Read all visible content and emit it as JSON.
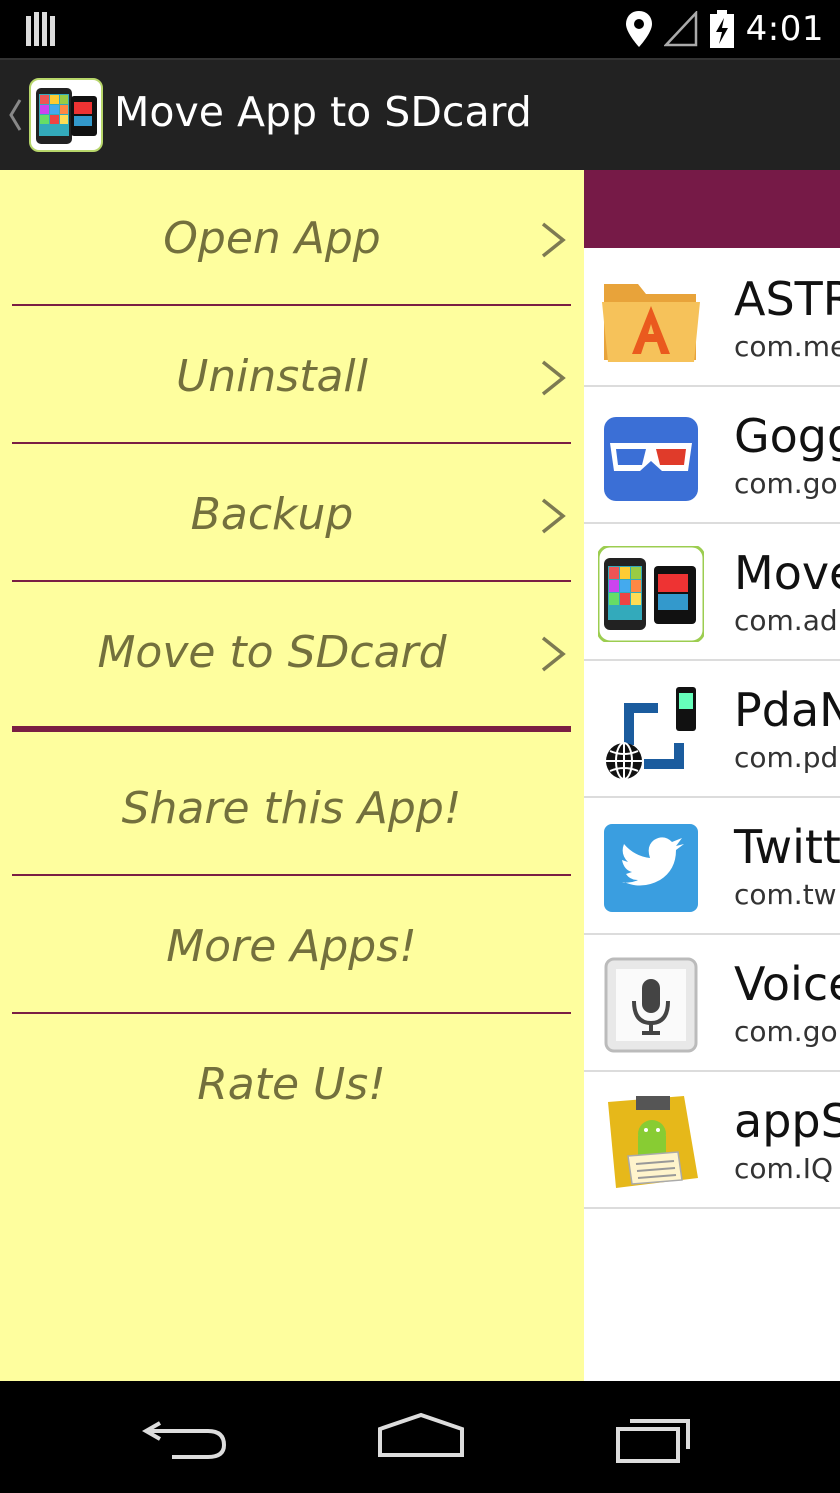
{
  "status_bar": {
    "time": "4:01",
    "icons": [
      "notification-bars-icon",
      "location-icon",
      "signal-icon",
      "battery-charging-icon"
    ]
  },
  "action_bar": {
    "title": "Move App to SDcard",
    "icons": [
      "up-caret-icon",
      "app-logo-icon"
    ]
  },
  "drawer": {
    "items": [
      {
        "label": "Open App"
      },
      {
        "label": "Uninstall"
      },
      {
        "label": "Backup"
      },
      {
        "label": "Move to SDcard"
      },
      {
        "label": "Share this App!"
      },
      {
        "label": "More Apps!"
      },
      {
        "label": "Rate Us!"
      }
    ]
  },
  "app_list": {
    "strip_color": "#761a47",
    "items": [
      {
        "name": "ASTR",
        "package": "com.me",
        "icon": "astro-folder-icon"
      },
      {
        "name": "Gogg",
        "package": "com.go",
        "icon": "goggles-icon"
      },
      {
        "name": "Move",
        "package": "com.ad",
        "icon": "move-app-icon"
      },
      {
        "name": "PdaN",
        "package": "com.pd",
        "icon": "pdanet-icon"
      },
      {
        "name": "Twitt",
        "package": "com.tw",
        "icon": "twitter-icon"
      },
      {
        "name": "Voice",
        "package": "com.go",
        "icon": "voice-search-icon"
      },
      {
        "name": "appS",
        "package": "com.IQ",
        "icon": "app-saver-icon"
      }
    ]
  },
  "nav_bar": {
    "icons": [
      "back-icon",
      "home-icon",
      "recents-icon"
    ]
  },
  "colors": {
    "drawer_bg": "#fefe9e",
    "drawer_text": "#73703d",
    "divider": "#7a1e43",
    "action_bar": "#222222"
  }
}
